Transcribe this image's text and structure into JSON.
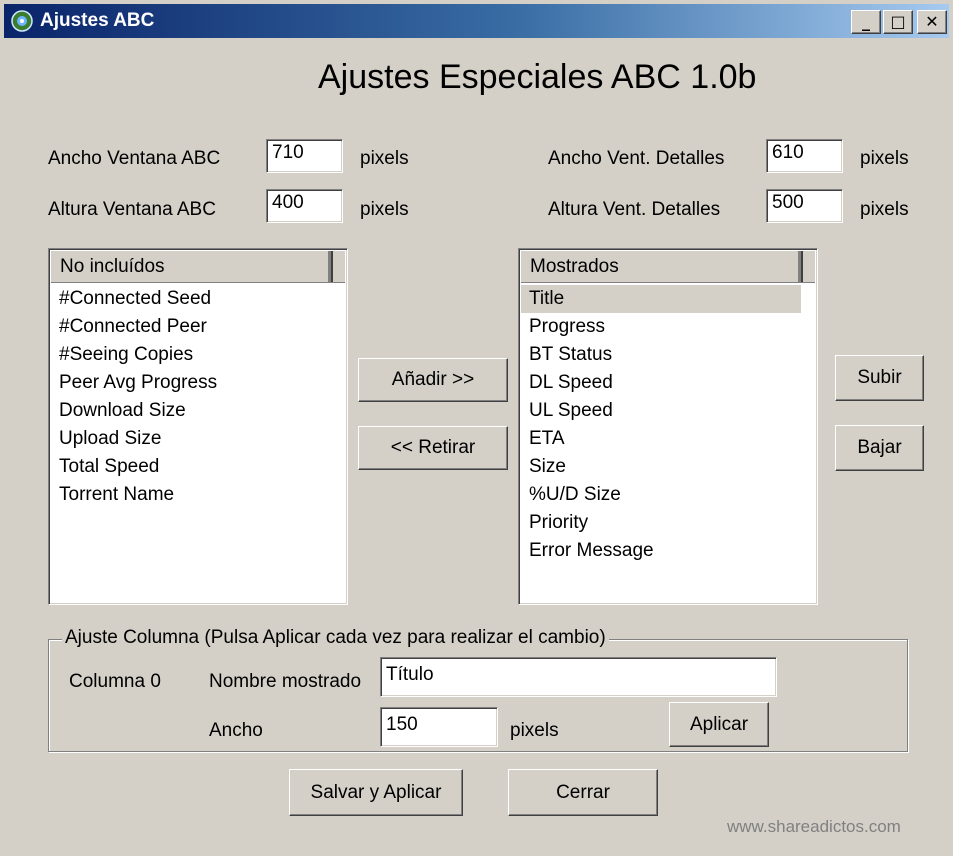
{
  "window": {
    "title": "Ajustes ABC",
    "minimize": "_",
    "maximize": "□",
    "close": "✕"
  },
  "heading": "Ajustes Especiales ABC 1.0b",
  "dimensions": {
    "main_width_label": "Ancho Ventana ABC",
    "main_width_value": "710",
    "main_height_label": "Altura Ventana ABC",
    "main_height_value": "400",
    "detail_width_label": "Ancho Vent. Detalles",
    "detail_width_value": "610",
    "detail_height_label": "Altura Vent. Detalles",
    "detail_height_value": "500",
    "unit": "pixels"
  },
  "excluded_list": {
    "header": "No incluídos",
    "items": [
      "#Connected Seed",
      "#Connected Peer",
      "#Seeing Copies",
      "Peer Avg Progress",
      "Download Size",
      "Upload Size",
      "Total Speed",
      "Torrent Name"
    ]
  },
  "shown_list": {
    "header": "Mostrados",
    "items": [
      "Title",
      "Progress",
      "BT Status",
      "DL Speed",
      "UL Speed",
      "ETA",
      "Size",
      "%U/D Size",
      "Priority",
      "Error Message"
    ],
    "selected": "Title"
  },
  "buttons": {
    "add": "Añadir >>",
    "remove": "<< Retirar",
    "up": "Subir",
    "down": "Bajar",
    "apply": "Aplicar",
    "save_apply": "Salvar y Aplicar",
    "close": "Cerrar"
  },
  "column_settings": {
    "legend": "Ajuste Columna (Pulsa Aplicar cada vez para realizar el cambio)",
    "column_label": "Columna 0",
    "display_name_label": "Nombre mostrado",
    "display_name_value": "Título",
    "width_label": "Ancho",
    "width_value": "150",
    "unit": "pixels"
  },
  "watermark": "www.shareadictos.com"
}
